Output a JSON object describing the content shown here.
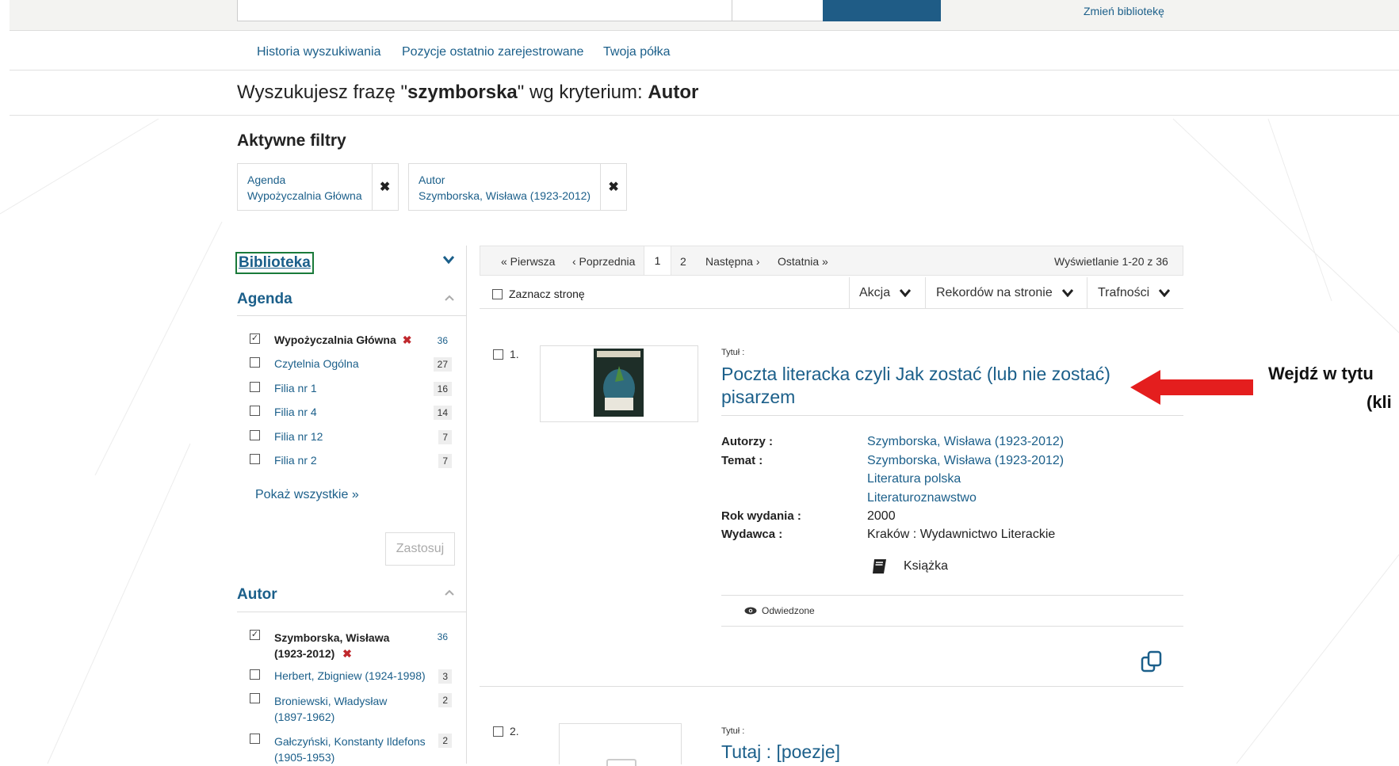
{
  "topbar": {
    "change_library": "Zmień bibliotekę"
  },
  "nav": [
    "Historia wyszukiwania",
    "Pozycje ostatnio zarejestrowane",
    "Twoja półka"
  ],
  "search_phrase": {
    "prefix": "Wyszukujesz frazę \"",
    "term": "szymborska",
    "middle": "\" wg kryterium: ",
    "criterion": "Autor"
  },
  "active_filters": {
    "heading": "Aktywne filtry",
    "chips": [
      {
        "label": "Agenda",
        "value": "Wypożyczalnia Główna",
        "remove": "✖"
      },
      {
        "label": "Autor",
        "value": "Szymborska, Wisława (1923-2012)",
        "remove": "✖"
      }
    ]
  },
  "sidebar": {
    "library_heading": "Biblioteka",
    "agenda_heading": "Agenda",
    "agenda_items": [
      {
        "label": "Wypożyczalnia Główna",
        "count": "36",
        "checked": true
      },
      {
        "label": "Czytelnia Ogólna",
        "count": "27",
        "checked": false
      },
      {
        "label": "Filia nr 1",
        "count": "16",
        "checked": false
      },
      {
        "label": "Filia nr 4",
        "count": "14",
        "checked": false
      },
      {
        "label": "Filia nr 12",
        "count": "7",
        "checked": false
      },
      {
        "label": "Filia nr 2",
        "count": "7",
        "checked": false
      }
    ],
    "show_all": "Pokaż wszystkie »",
    "apply": "Zastosuj",
    "author_heading": "Autor",
    "author_items": [
      {
        "line1": "Szymborska, Wisława",
        "line2": "(1923-2012)",
        "count": "36",
        "checked": true
      },
      {
        "line1": "Herbert, Zbigniew (1924-1998)",
        "line2": "",
        "count": "3",
        "checked": false
      },
      {
        "line1": "Broniewski, Władysław",
        "line2": "(1897-1962)",
        "count": "2",
        "checked": false
      },
      {
        "line1": "Gałczyński, Konstanty Ildefons",
        "line2": "(1905-1953)",
        "count": "2",
        "checked": false
      }
    ],
    "remove_mark": "✖"
  },
  "pagination": {
    "first": "« Pierwsza",
    "prev": "‹ Poprzednia",
    "current": "1",
    "page2": "2",
    "next": "Następna ›",
    "last": "Ostatnia »",
    "showing": "Wyświetlanie 1-20 z 36"
  },
  "toolbar": {
    "select_page": "Zaznacz stronę",
    "action": "Akcja",
    "per_page": "Rekordów na stronie",
    "sort": "Trafności"
  },
  "results": [
    {
      "number": "1.",
      "title_label": "Tytuł :",
      "title_line1": "Poczta literacka czyli Jak zostać (lub nie zostać)",
      "title_line2": "pisarzem",
      "authors_label": "Autorzy :",
      "authors": "Szymborska, Wisława (1923-2012)",
      "subject_label": "Temat :",
      "subjects": [
        "Szymborska, Wisława (1923-2012)",
        "Literatura polska",
        "Literaturoznawstwo"
      ],
      "year_label": "Rok wydania :",
      "year": "2000",
      "publisher_label": "Wydawca :",
      "publisher": "Kraków : Wydawnictwo Literackie",
      "format": "Książka",
      "visited": "Odwiedzone"
    },
    {
      "number": "2.",
      "title_label": "Tytuł :",
      "title_line1": "Tutaj : [poezje]"
    }
  ],
  "annotation": {
    "line1": "Wejdź w tytu",
    "line2": "(kli"
  }
}
